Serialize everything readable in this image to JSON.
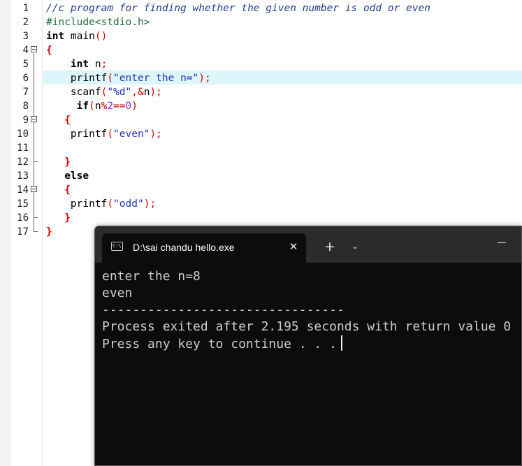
{
  "editor": {
    "line_numbers": [
      "1",
      "2",
      "3",
      "4",
      "5",
      "6",
      "7",
      "8",
      "9",
      "10",
      "11",
      "12",
      "13",
      "14",
      "15",
      "16",
      "17"
    ],
    "lines": [
      [
        {
          "t": "//c program for finding whether the given number is odd or even",
          "c": "cm"
        }
      ],
      [
        {
          "t": "#include<stdio.h>",
          "c": "pp"
        }
      ],
      [
        {
          "t": "int",
          "c": "kw"
        },
        {
          "t": " main",
          "c": "fn"
        },
        {
          "t": "()",
          "c": "op"
        }
      ],
      [
        {
          "t": "{",
          "c": "br"
        }
      ],
      [
        {
          "t": "    int",
          "c": "kw"
        },
        {
          "t": " n",
          "c": "fn"
        },
        {
          "t": ";",
          "c": "op"
        }
      ],
      [
        {
          "t": "    printf",
          "c": "fn"
        },
        {
          "t": "(",
          "c": "op"
        },
        {
          "t": "\"enter the n=\"",
          "c": "st"
        },
        {
          "t": ");",
          "c": "op"
        }
      ],
      [
        {
          "t": "    scanf",
          "c": "fn"
        },
        {
          "t": "(",
          "c": "op"
        },
        {
          "t": "\"%d\"",
          "c": "st"
        },
        {
          "t": ",",
          "c": "op"
        },
        {
          "t": "&",
          "c": "op"
        },
        {
          "t": "n",
          "c": "fn"
        },
        {
          "t": ");",
          "c": "op"
        }
      ],
      [
        {
          "t": "     if",
          "c": "kw"
        },
        {
          "t": "(",
          "c": "op"
        },
        {
          "t": "n",
          "c": "fn"
        },
        {
          "t": "%",
          "c": "op"
        },
        {
          "t": "2",
          "c": "nm"
        },
        {
          "t": "==",
          "c": "op"
        },
        {
          "t": "0",
          "c": "nm"
        },
        {
          "t": ")",
          "c": "op"
        }
      ],
      [
        {
          "t": "   {",
          "c": "br"
        }
      ],
      [
        {
          "t": "    printf",
          "c": "fn"
        },
        {
          "t": "(",
          "c": "op"
        },
        {
          "t": "\"even\"",
          "c": "st"
        },
        {
          "t": ");",
          "c": "op"
        }
      ],
      [
        {
          "t": "",
          "c": "fn"
        }
      ],
      [
        {
          "t": "   }",
          "c": "br"
        }
      ],
      [
        {
          "t": "   else",
          "c": "kw"
        }
      ],
      [
        {
          "t": "   {",
          "c": "br"
        }
      ],
      [
        {
          "t": "    printf",
          "c": "fn"
        },
        {
          "t": "(",
          "c": "op"
        },
        {
          "t": "\"odd\"",
          "c": "st"
        },
        {
          "t": ");",
          "c": "op"
        }
      ],
      [
        {
          "t": "   }",
          "c": "br"
        }
      ],
      [
        {
          "t": "}",
          "c": "br"
        }
      ]
    ],
    "highlighted_line": 6
  },
  "console": {
    "icon_text": "C:\\",
    "tab_title": "D:\\sai chandu hello.exe",
    "close_glyph": "✕",
    "new_tab_glyph": "+",
    "dropdown_glyph": "⌄",
    "output": {
      "line1": "enter the n=8",
      "line2": "even",
      "separator": "--------------------------------",
      "line3": "Process exited after 2.195 seconds with return value 0",
      "line4": "Press any key to continue . . ."
    }
  },
  "colors": {
    "comment": "#1f3a8f",
    "preprocessor": "#1f6a3a",
    "operator": "#d20000",
    "string": "#1f35b5",
    "number": "#8a2be2",
    "current_line": "#ddf6fb",
    "console_bg": "#0c0c0c",
    "console_text": "#cccccc"
  }
}
